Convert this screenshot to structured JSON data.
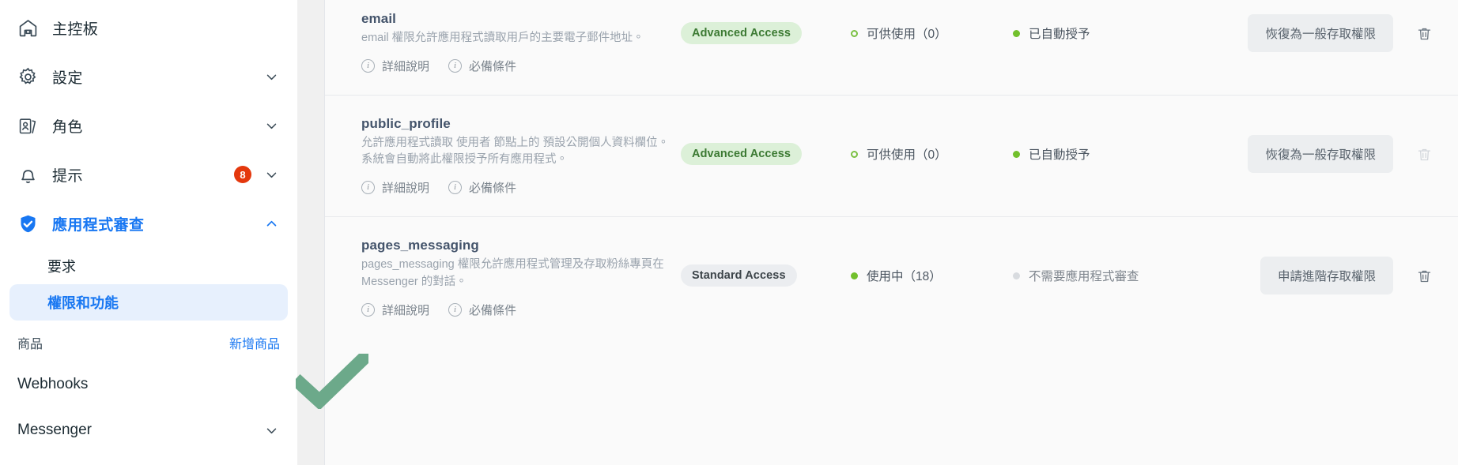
{
  "sidebar": {
    "items": [
      {
        "label": "主控板",
        "icon": "home-icon",
        "expandable": false,
        "badge": ""
      },
      {
        "label": "設定",
        "icon": "gear-icon",
        "expandable": true,
        "badge": ""
      },
      {
        "label": "角色",
        "icon": "id-card-icon",
        "expandable": true,
        "badge": ""
      },
      {
        "label": "提示",
        "icon": "bell-icon",
        "expandable": true,
        "badge": "8"
      },
      {
        "label": "應用程式審查",
        "icon": "shield-check-icon",
        "expandable": true,
        "badge": "",
        "active": true,
        "collapse": true
      }
    ],
    "sub_items": [
      {
        "label": "要求",
        "selected": false
      },
      {
        "label": "權限和功能",
        "selected": true
      }
    ],
    "products_section": {
      "title": "商品",
      "action_label": "新增商品"
    },
    "products": [
      {
        "label": "Webhooks",
        "expandable": false
      },
      {
        "label": "Messenger",
        "expandable": true
      }
    ]
  },
  "permissions": [
    {
      "name": "email",
      "description": "email 權限允許應用程式讀取用戶的主要電子郵件地址。",
      "links": [
        "詳細說明",
        "必備條件"
      ],
      "access_badge": "Advanced Access",
      "access_level": "advanced",
      "usage": "可供使用（0）",
      "usage_dot": "hollow",
      "status": "已自動授予",
      "status_dot": "solid",
      "button": "恢復為一般存取權限",
      "delete_enabled": true
    },
    {
      "name": "public_profile",
      "description": "允許應用程式讀取 使用者 節點上的 預設公開個人資料欄位。系統會自動將此權限授予所有應用程式。",
      "links": [
        "詳細說明",
        "必備條件"
      ],
      "access_badge": "Advanced Access",
      "access_level": "advanced",
      "usage": "可供使用（0）",
      "usage_dot": "hollow",
      "status": "已自動授予",
      "status_dot": "solid",
      "button": "恢復為一般存取權限",
      "delete_enabled": false
    },
    {
      "name": "pages_messaging",
      "description": "pages_messaging 權限允許應用程式管理及存取粉絲專頁在 Messenger 的對話。",
      "links": [
        "詳細說明",
        "必備條件"
      ],
      "access_badge": "Standard Access",
      "access_level": "standard",
      "usage": "使用中（18）",
      "usage_dot": "solid",
      "status": "不需要應用程式審查",
      "status_dot": "grey",
      "button": "申請進階存取權限",
      "delete_enabled": true
    }
  ],
  "annotation": {
    "check_color": "#6ca98a"
  },
  "colors": {
    "accent": "#1877f2",
    "badge_advanced_bg": "#dcf0d8",
    "badge_advanced_text": "#3c7a33",
    "badge_standard_bg": "#ebedf0",
    "badge_standard_text": "#3c4449",
    "notification_red": "#e4380d",
    "dot_green": "#72c02c"
  }
}
